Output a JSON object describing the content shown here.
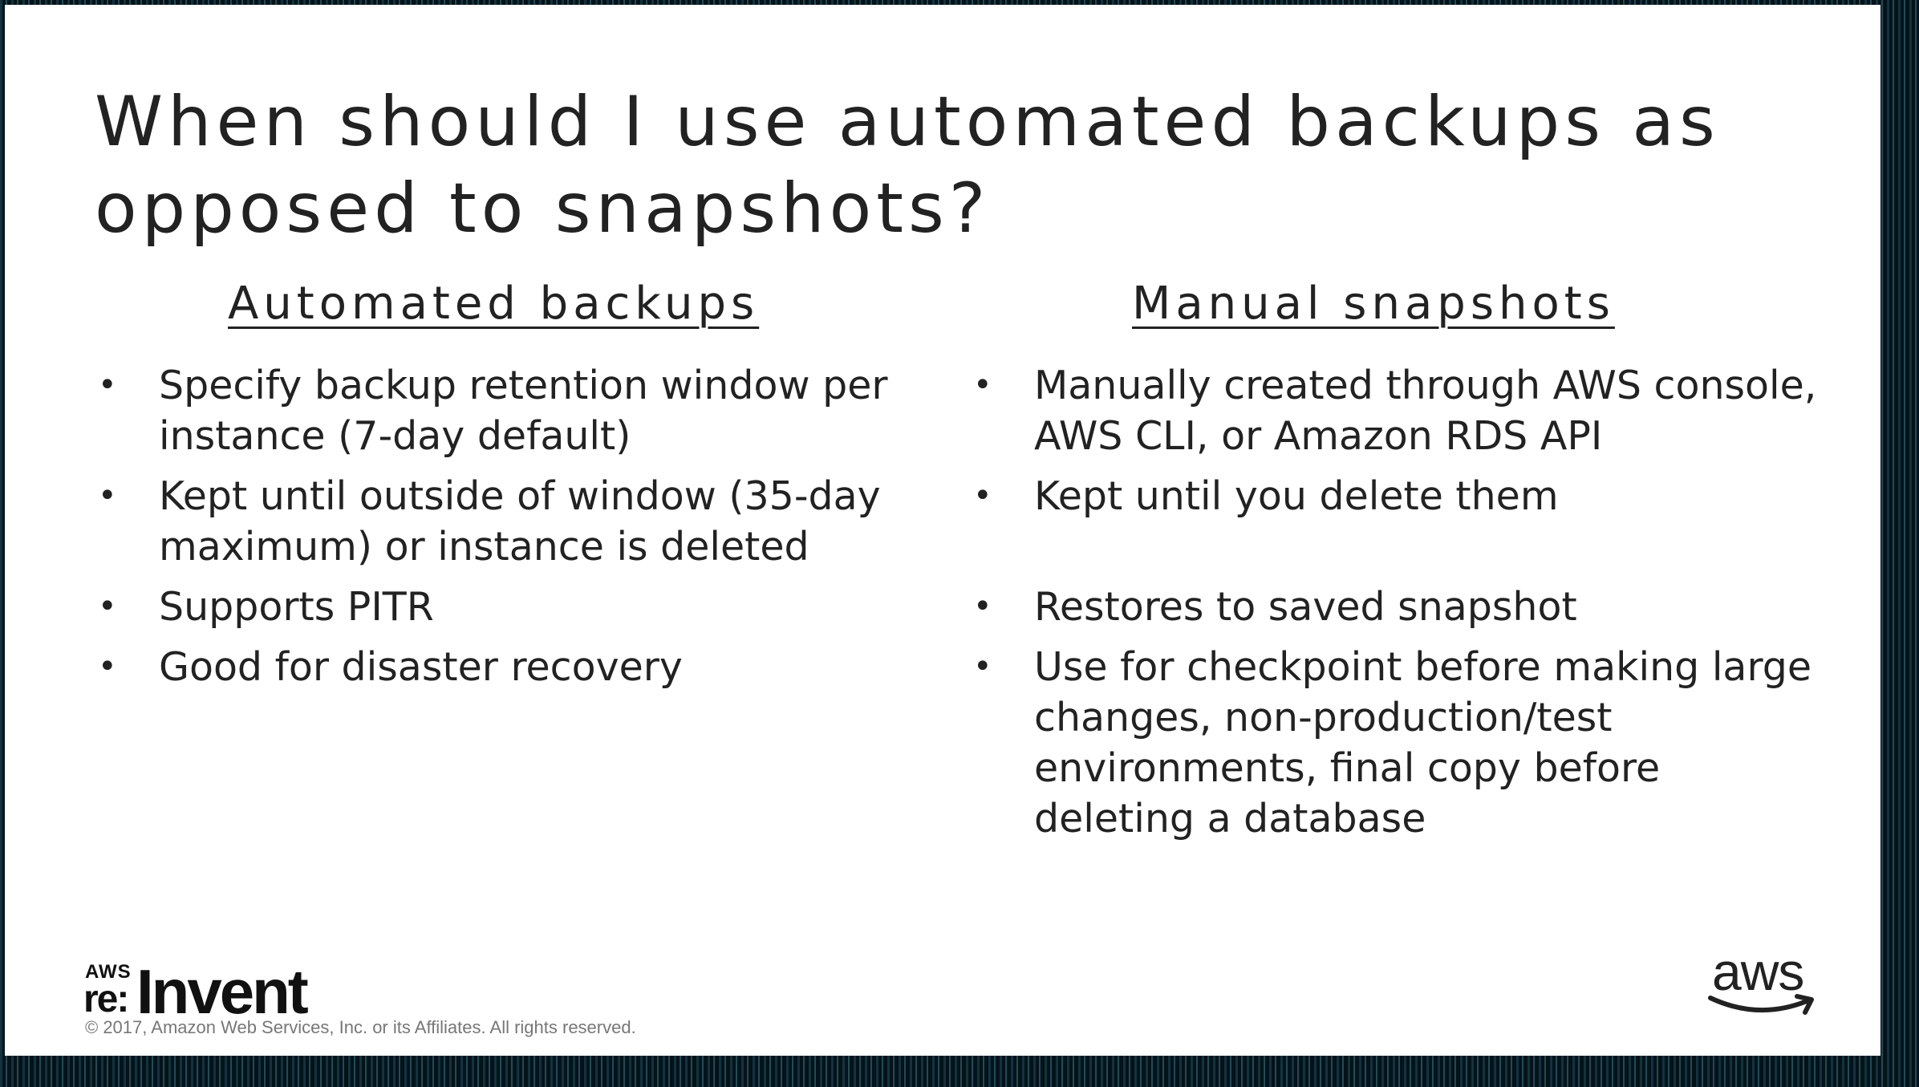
{
  "slide": {
    "title": "When should I use automated backups as opposed to snapshots?",
    "left_column": {
      "heading": "Automated backups",
      "bullets": [
        "Specify backup retention window per instance (7-day default)",
        "Kept until outside of window (35-day maximum) or instance is deleted",
        "Supports PITR",
        "Good for disaster recovery"
      ]
    },
    "right_column": {
      "heading": "Manual snapshots",
      "bullets": [
        "Manually created through AWS console, AWS CLI, or Amazon RDS API",
        "Kept until you delete them",
        "Restores to saved snapshot",
        "Use for checkpoint before making large changes, non-production/test environments, final copy before deleting a database"
      ]
    },
    "bullet_glyph": "•"
  },
  "footer": {
    "logo_small": "AWS",
    "logo_re": "re:",
    "logo_invent": "Invent",
    "copyright": "© 2017, Amazon Web Services, Inc. or its Affiliates. All rights reserved.",
    "aws_logo_text": "aws"
  },
  "colors": {
    "text": "#222222",
    "aws_smile": "#222222",
    "background_frame": "#0a1b22"
  }
}
